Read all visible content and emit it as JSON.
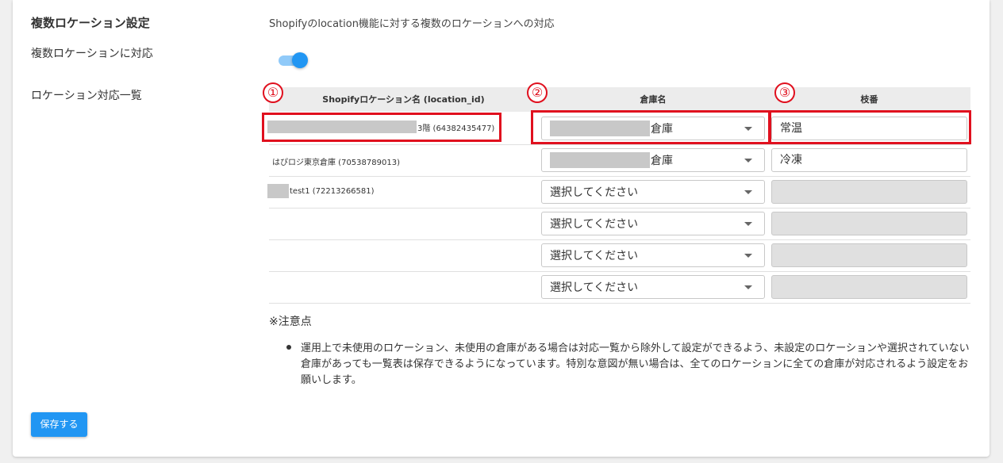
{
  "settings": {
    "section_title": "複数ロケーション設定",
    "description": "Shopifyのlocation機能に対する複数のロケーションへの対応",
    "multi_location_label": "複数ロケーションに対応",
    "multi_location_enabled": true,
    "location_list_label": "ロケーション対応一覧"
  },
  "table": {
    "headers": {
      "location": "Shopifyロケーション名 (location_id)",
      "warehouse": "倉庫名",
      "branch": "枝番"
    },
    "rows": [
      {
        "location": "3階 (64382435477)",
        "warehouse": "倉庫",
        "branch": "常温"
      },
      {
        "location": "はぴロジ東京倉庫 (70538789013)",
        "warehouse": "倉庫",
        "branch": "冷凍"
      },
      {
        "location": "test1 (72213266581)",
        "warehouse": "選択してください",
        "branch": ""
      },
      {
        "location": "",
        "warehouse": "選択してください",
        "branch": ""
      },
      {
        "location": "",
        "warehouse": "選択してください",
        "branch": ""
      },
      {
        "location": "",
        "warehouse": "選択してください",
        "branch": ""
      }
    ]
  },
  "annotations": {
    "one": "①",
    "two": "②",
    "three": "③",
    "color": "#e0101e"
  },
  "notice": {
    "title": "※注意点",
    "text": "運用上で未使用のロケーション、未使用の倉庫がある場合は対応一覧から除外して設定ができるよう、未設定のロケーションや選択されていない倉庫があっても一覧表は保存できるようになっています。特別な意図が無い場合は、全てのロケーションに全ての倉庫が対応されるよう設定をお願いします。"
  },
  "save_button": "保存する",
  "colors": {
    "accent": "#2196f3",
    "toggle_track": "#90caf9"
  }
}
